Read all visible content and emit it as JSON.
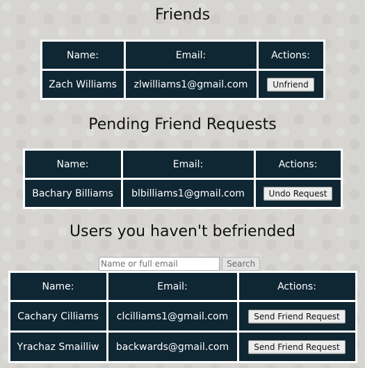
{
  "friends": {
    "title": "Friends",
    "headers": [
      "Name:",
      "Email:",
      "Actions:"
    ],
    "rows": [
      {
        "name": "Zach Williams",
        "email": "zlwilliams1@gmail.com",
        "action": "Unfriend"
      }
    ]
  },
  "pending": {
    "title": "Pending Friend Requests",
    "headers": [
      "Name:",
      "Email:",
      "Actions:"
    ],
    "rows": [
      {
        "name": "Bachary Billiams",
        "email": "blbilliams1@gmail.com",
        "action": "Undo Request"
      }
    ]
  },
  "others": {
    "title": "Users you haven't befriended",
    "search": {
      "placeholder": "Name or full email",
      "button": "Search"
    },
    "headers": [
      "Name:",
      "Email:",
      "Actions:"
    ],
    "rows": [
      {
        "name": "Cachary Cilliams",
        "email": "clcilliams1@gmail.com",
        "action": "Send Friend Request"
      },
      {
        "name": "Yrachaz Smailliw",
        "email": "backwards@gmail.com",
        "action": "Send Friend Request"
      }
    ]
  }
}
